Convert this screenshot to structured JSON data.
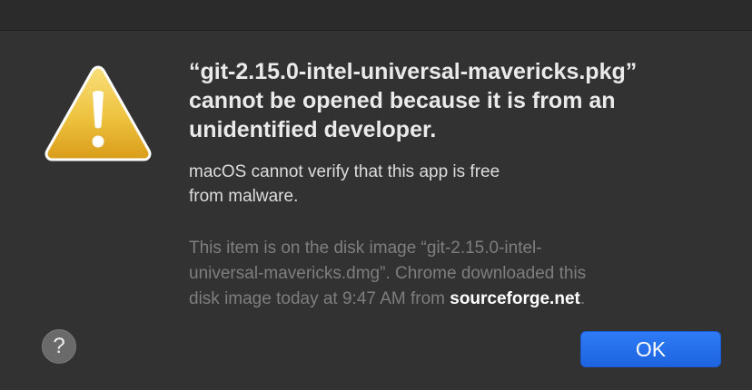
{
  "dialog": {
    "title_lines": [
      "“git-2.15.0-intel-universal-mavericks.pkg”",
      "cannot be opened because it is from an",
      "unidentified developer."
    ],
    "message_lines": [
      "macOS cannot verify that this app is free",
      "from malware."
    ],
    "info": {
      "line1": "This item is on the disk image “git-2.15.0-intel-",
      "line2": "universal-mavericks.dmg”. Chrome downloaded this",
      "line3_prefix": "disk image today at 9:47 AM from ",
      "host": "sourceforge.net",
      "line3_suffix": "."
    },
    "icon": "warning-triangle-icon",
    "help_label": "?",
    "ok_label": "OK"
  },
  "colors": {
    "background": "#323232",
    "title_text": "#eaeaea",
    "info_text": "#7e7e7e",
    "ok_button": "#1f6bf0",
    "warning_yellow": "#f2c23a"
  }
}
